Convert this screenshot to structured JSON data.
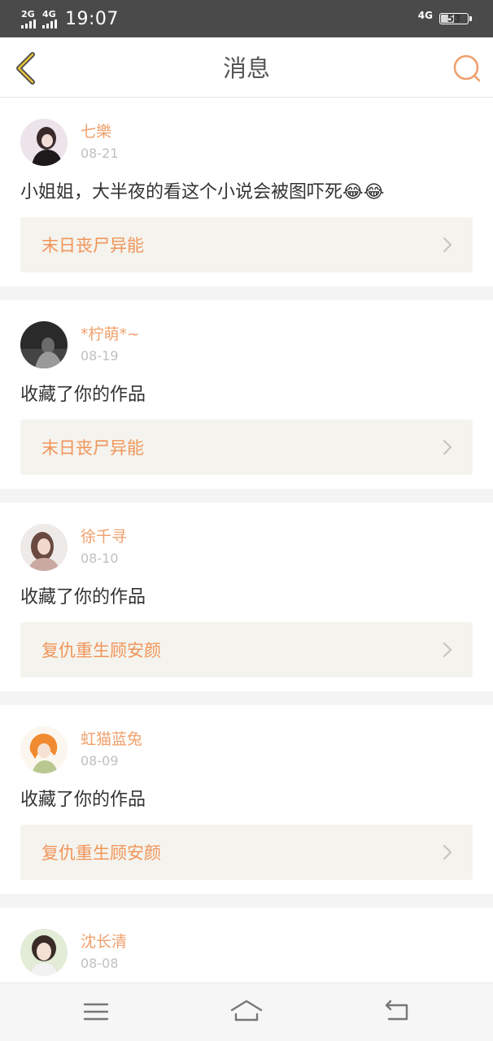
{
  "status_bar": {
    "sim1": "2G",
    "sim2": "4G",
    "time": "19:07",
    "network": "4G",
    "battery": "53",
    "battery_level": 0.53
  },
  "header": {
    "title": "消息",
    "back_icon": "chevron-left-icon",
    "search_icon": "search-icon"
  },
  "messages": [
    {
      "name": "七樂",
      "date": "08-21",
      "text": "小姐姐，大半夜的看这个小说会被图吓死",
      "emojis": "😂😂",
      "work": "末日丧尸异能"
    },
    {
      "name": "*柠萌*~",
      "date": "08-19",
      "text": "收藏了你的作品",
      "work": "末日丧尸异能"
    },
    {
      "name": "徐千寻",
      "date": "08-10",
      "text": "收藏了你的作品",
      "work": "复仇重生顾安颜"
    },
    {
      "name": "虹猫蓝兔",
      "date": "08-09",
      "text": "收藏了你的作品",
      "work": "复仇重生顾安颜"
    },
    {
      "name": "沈长清",
      "date": "08-08"
    }
  ],
  "nav": {
    "menu_icon": "menu-icon",
    "home_icon": "home-icon",
    "back_icon": "back-icon"
  },
  "colors": {
    "accent": "#f0a06c",
    "status_bar": "#4a4a4a",
    "card_link_bg": "#f5f3ed"
  }
}
